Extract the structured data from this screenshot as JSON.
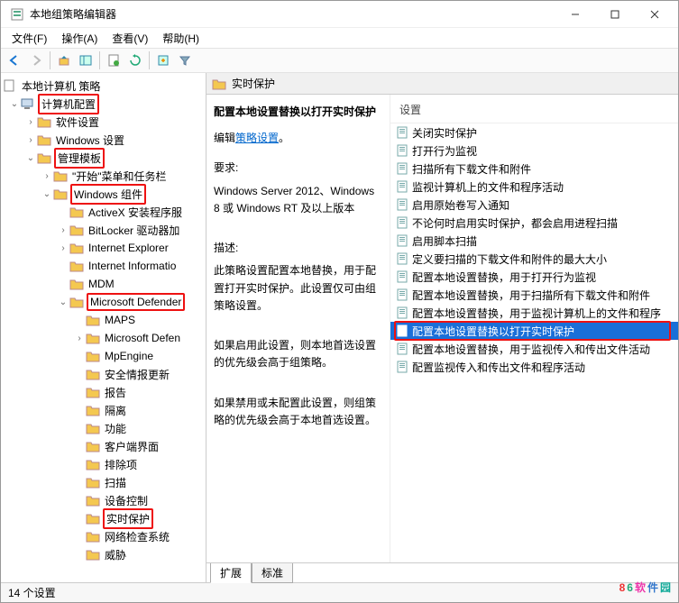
{
  "window": {
    "title": "本地组策略编辑器"
  },
  "menus": {
    "file": "文件(F)",
    "action": "操作(A)",
    "view": "查看(V)",
    "help": "帮助(H)"
  },
  "tree": {
    "root": "本地计算机 策略",
    "computer_cfg": "计算机配置",
    "software": "软件设置",
    "windows_settings": "Windows 设置",
    "admin_templates": "管理模板",
    "start_taskbar": "\"开始\"菜单和任务栏",
    "win_components": "Windows 组件",
    "activex": "ActiveX 安装程序服",
    "bitlocker": "BitLocker 驱动器加",
    "ie": "Internet Explorer",
    "iis": "Internet Informatio",
    "mdm": "MDM",
    "defender": "Microsoft Defender",
    "maps": "MAPS",
    "msdef": "Microsoft Defen",
    "mpengine": "MpEngine",
    "security_update": "安全情报更新",
    "report": "报告",
    "quarantine": "隔离",
    "features": "功能",
    "client_ui": "客户端界面",
    "exclusions": "排除项",
    "scan": "扫描",
    "device_control": "设备控制",
    "realtime": "实时保护",
    "network_inspect": "网络检查系统",
    "threats": "威胁"
  },
  "header": {
    "title": "实时保护"
  },
  "detail": {
    "title": "配置本地设置替换以打开实时保护",
    "edit_prefix": "编辑",
    "edit_link": "策略设置",
    "req_label": "要求:",
    "req_text": "Windows Server 2012、Windows 8 或 Windows RT 及以上版本",
    "desc_label": "描述:",
    "desc_1": "此策略设置配置本地替换，用于配置打开实时保护。此设置仅可由组策略设置。",
    "desc_2": "    如果启用此设置，则本地首选设置的优先级会高于组策略。",
    "desc_3": "    如果禁用或未配置此设置，则组策略的优先级会高于本地首选设置。"
  },
  "column": {
    "setting": "设置"
  },
  "items": [
    "关闭实时保护",
    "打开行为监视",
    "扫描所有下载文件和附件",
    "监视计算机上的文件和程序活动",
    "启用原始卷写入通知",
    "不论何时启用实时保护，都会启用进程扫描",
    "启用脚本扫描",
    "定义要扫描的下载文件和附件的最大大小",
    "配置本地设置替换，用于打开行为监视",
    "配置本地设置替换，用于扫描所有下载文件和附件",
    "配置本地设置替换，用于监视计算机上的文件和程序",
    "配置本地设置替换以打开实时保护",
    "配置本地设置替换，用于监视传入和传出文件活动",
    "配置监视传入和传出文件和程序活动"
  ],
  "tabs": {
    "extended": "扩展",
    "standard": "标准"
  },
  "status": "14 个设置",
  "watermark": [
    "8",
    "6",
    "软",
    "件",
    "园"
  ]
}
